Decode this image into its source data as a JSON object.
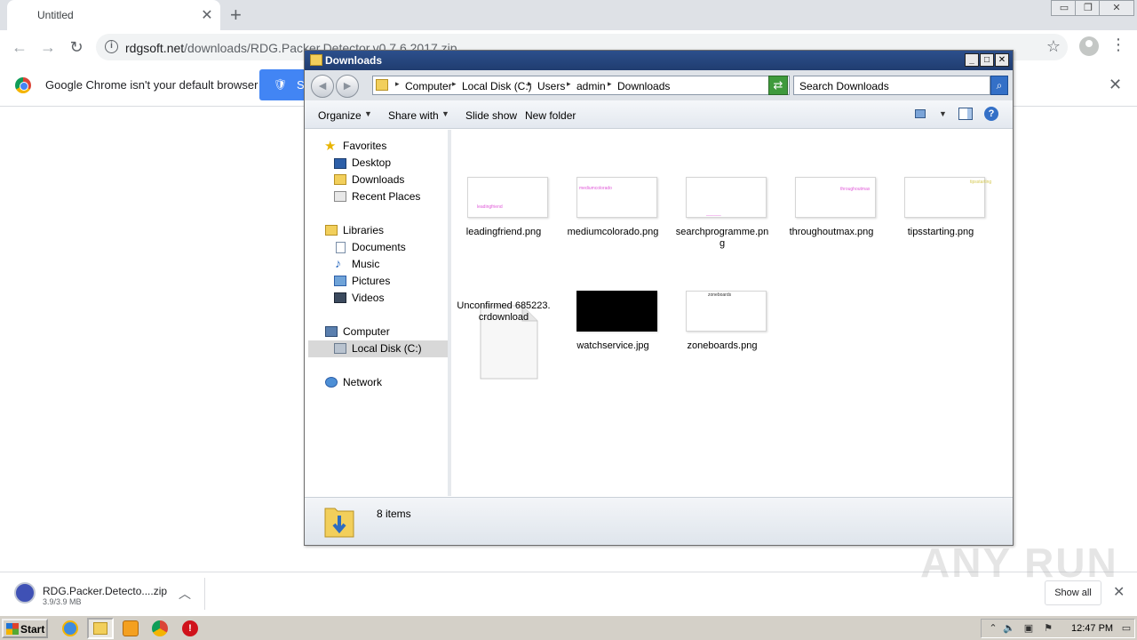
{
  "browser": {
    "tab_title": "Untitled",
    "tab_close": "✕",
    "new_tab": "+",
    "url_host": "rdgsoft.net",
    "url_path": "/downloads/RDG.Packer.Detector.v0.7.6.2017.zip",
    "infobar_message": "Google Chrome isn't your default browser",
    "infobar_button": "S",
    "infobar_close": "✕"
  },
  "explorer": {
    "title": "Downloads",
    "breadcrumbs": [
      "Computer",
      "Local Disk (C:)",
      "Users",
      "admin",
      "Downloads"
    ],
    "search_placeholder": "Search Downloads",
    "commands": {
      "organize": "Organize",
      "share_with": "Share with",
      "slide_show": "Slide show",
      "new_folder": "New folder"
    },
    "nav": {
      "favorites": "Favorites",
      "desktop": "Desktop",
      "downloads": "Downloads",
      "recent_places": "Recent Places",
      "libraries": "Libraries",
      "documents": "Documents",
      "music": "Music",
      "pictures": "Pictures",
      "videos": "Videos",
      "computer": "Computer",
      "local_disk": "Local Disk (C:)",
      "network": "Network"
    },
    "files": [
      {
        "name": "leadingfriend.png",
        "thumb_text": "leadingfriend"
      },
      {
        "name": "mediumcolorado.png",
        "thumb_text": "mediumcolorado"
      },
      {
        "name": "searchprogramme.png",
        "thumb_text": "______"
      },
      {
        "name": "throughoutmax.png",
        "thumb_text": "throughoutmax"
      },
      {
        "name": "tipsstarting.png",
        "thumb_text": "tipsstarting"
      },
      {
        "name": "Unconfirmed 685223.crdownload",
        "thumb_text": ""
      },
      {
        "name": "watchservice.jpg",
        "thumb_text": ""
      },
      {
        "name": "zoneboards.png",
        "thumb_text": "zoneboards"
      }
    ],
    "status": "8 items"
  },
  "download_shelf": {
    "file_name": "RDG.Packer.Detecto....zip",
    "file_size": "3.9/3.9 MB",
    "show_all": "Show all",
    "close": "✕"
  },
  "watermark": "ANY RUN",
  "taskbar": {
    "start_label": "Start",
    "clock": "12:47 PM"
  },
  "colors": {
    "explorer_title_bg": "#203d70",
    "chrome_button_blue": "#4285f4",
    "taskbar_bg": "#d4d0c8"
  }
}
